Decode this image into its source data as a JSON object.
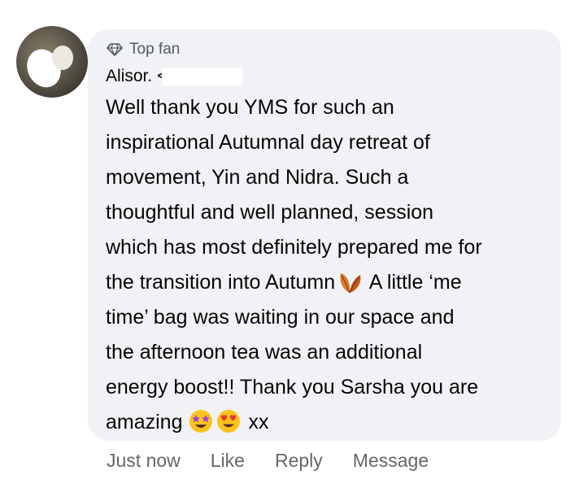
{
  "badge": {
    "icon": "diamond-icon",
    "label": "Top fan"
  },
  "author": {
    "name": "Alisor. ˂"
  },
  "comment": {
    "lines": [
      "Well thank you YMS for such an",
      "inspirational Autumnal day retreat of",
      "movement, Yin and Nidra. Such a",
      "thoughtful and well planned, session",
      "which has most definitely prepared me for"
    ],
    "line6_pre": "the transition into Autumn",
    "line6_post": " A little ‘me",
    "line7": "time’ bag was waiting in our space and",
    "line8": "the afternoon tea was an additional",
    "line9": "energy boost!! Thank you Sarsha you are",
    "line10_pre": "amazing",
    "line10_post": "xx",
    "emojis": [
      "falling-leaf-emoji",
      "star-struck-emoji",
      "heart-eyes-emoji"
    ]
  },
  "actions": {
    "time": "Just now",
    "like": "Like",
    "reply": "Reply",
    "message": "Message"
  },
  "colors": {
    "bubble": "#f0f2f5",
    "text": "#050505",
    "muted": "#65676b"
  }
}
